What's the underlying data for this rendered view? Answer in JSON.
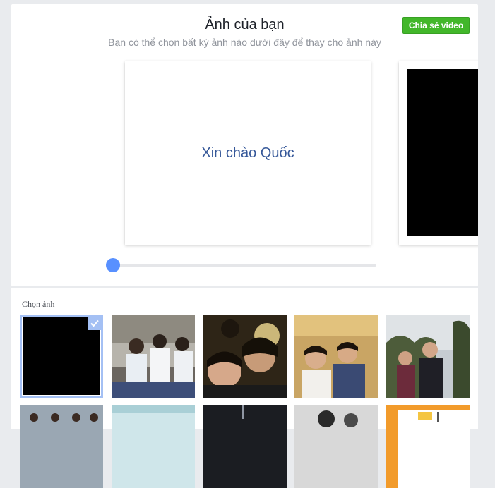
{
  "header": {
    "title": "Ảnh của bạn",
    "subtitle": "Bạn có thể chọn bất kỳ ảnh nào dưới đây để thay cho ảnh này",
    "share_button": "Chia sẻ video"
  },
  "preview": {
    "main_text": "Xin chào Quốc"
  },
  "slider": {
    "position_fraction": 0.0
  },
  "picker": {
    "label": "Chọn ảnh",
    "selected_index": 0,
    "accent": "#a4c0f4"
  },
  "colors": {
    "share_green": "#42b72a",
    "link_blue": "#365899",
    "slider_blue": "#5890ff"
  }
}
